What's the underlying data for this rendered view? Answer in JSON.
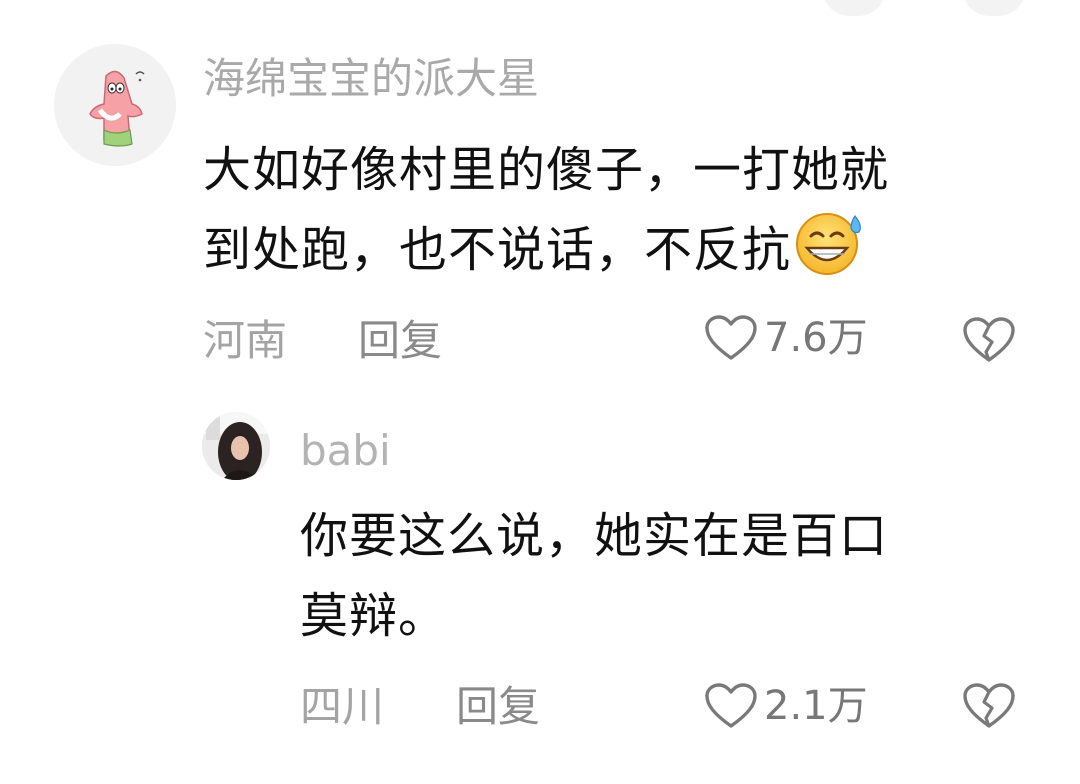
{
  "comments": [
    {
      "username": "海绵宝宝的派大星",
      "text_line1": "大如好像村里的傻子，一打她就",
      "text_line2": "到处跑，也不说话，不反抗",
      "emoji": "sweat-smile-emoji",
      "location": "河南",
      "reply_label": "回复",
      "likes": "7.6万",
      "avatar": "patrick-star-avatar"
    },
    {
      "username": "babi",
      "text_line1": "你要这么说，她实在是百口",
      "text_line2": "莫辩。",
      "location": "四川",
      "reply_label": "回复",
      "likes": "2.1万",
      "avatar": "profile-photo-avatar"
    }
  ],
  "icons": {
    "like": "heart-outline-icon",
    "dislike": "broken-heart-icon"
  },
  "colors": {
    "text": "#111111",
    "muted": "#a4a4a4",
    "background": "#ffffff"
  }
}
